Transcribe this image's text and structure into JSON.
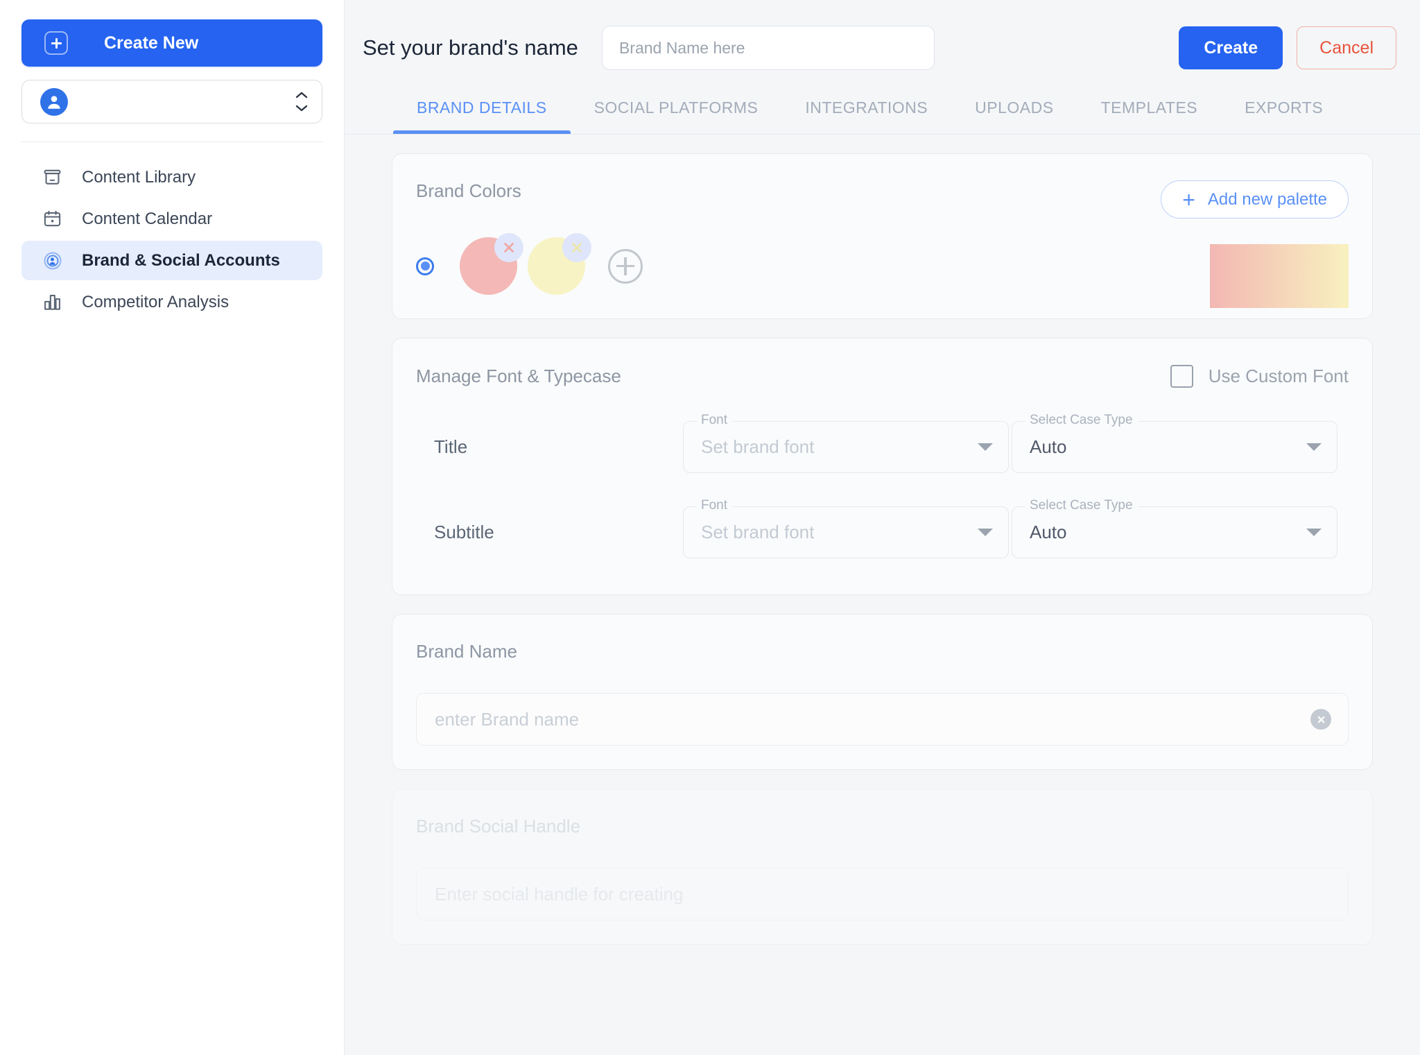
{
  "sidebar": {
    "create_button": {
      "label": "Create New",
      "icon": "plus-square-icon"
    },
    "account_select": {
      "value": "",
      "icon": "user-avatar-icon",
      "stepper_icon": "chevron-up-down-icon"
    },
    "items": [
      {
        "label": "Content Library",
        "icon": "archive-box-icon",
        "active": false
      },
      {
        "label": "Content Calendar",
        "icon": "calendar-icon",
        "active": false
      },
      {
        "label": "Brand & Social Accounts",
        "icon": "broadcast-person-icon",
        "active": true
      },
      {
        "label": "Competitor Analysis",
        "icon": "bar-chart-icon",
        "active": false
      }
    ]
  },
  "header": {
    "title": "Set your brand's name",
    "brand_name_input": {
      "value": "",
      "placeholder": "Brand Name here"
    },
    "create_label": "Create",
    "cancel_label": "Cancel"
  },
  "tabs": [
    {
      "label": "BRAND DETAILS",
      "active": true
    },
    {
      "label": "SOCIAL PLATFORMS",
      "active": false
    },
    {
      "label": "INTEGRATIONS",
      "active": false
    },
    {
      "label": "UPLOADS",
      "active": false
    },
    {
      "label": "TEMPLATES",
      "active": false
    },
    {
      "label": "EXPORTS",
      "active": false
    }
  ],
  "brand_colors": {
    "title": "Brand Colors",
    "add_palette_label": "Add new palette",
    "add_palette_icon": "plus-icon",
    "palette_selected": true,
    "swatches": [
      {
        "color": "#f4b8b6",
        "remove_icon": "close-icon"
      },
      {
        "color": "#f7f3c4",
        "remove_icon": "close-icon"
      }
    ],
    "add_color_icon": "plus-circle-icon",
    "gradient_preview": {
      "from": "#f3b7b3",
      "to": "#f8f1bf"
    }
  },
  "fonts": {
    "title": "Manage Font & Typecase",
    "custom_font": {
      "label": "Use Custom Font",
      "checked": false
    },
    "font_legend": "Font",
    "case_legend": "Select Case Type",
    "rows": [
      {
        "label": "Title",
        "font_value": "Set brand font",
        "font_is_placeholder": true,
        "case_value": "Auto",
        "caret_icon": "chevron-down-icon"
      },
      {
        "label": "Subtitle",
        "font_value": "Set brand font",
        "font_is_placeholder": true,
        "case_value": "Auto",
        "caret_icon": "chevron-down-icon"
      }
    ]
  },
  "brand_name_card": {
    "title": "Brand Name",
    "input": {
      "value": "",
      "placeholder": "enter Brand name"
    },
    "clear_icon": "clear-circle-icon"
  },
  "brand_social_card": {
    "title": "Brand Social Handle",
    "input": {
      "value": "",
      "placeholder": "Enter social handle for creating"
    }
  },
  "colors": {
    "accent_blue": "#2563f0",
    "tab_blue": "#5a90f5",
    "cancel_red": "#e8533c",
    "sidebar_active_bg": "#e6edfd",
    "page_bg": "#f4f6f8"
  }
}
